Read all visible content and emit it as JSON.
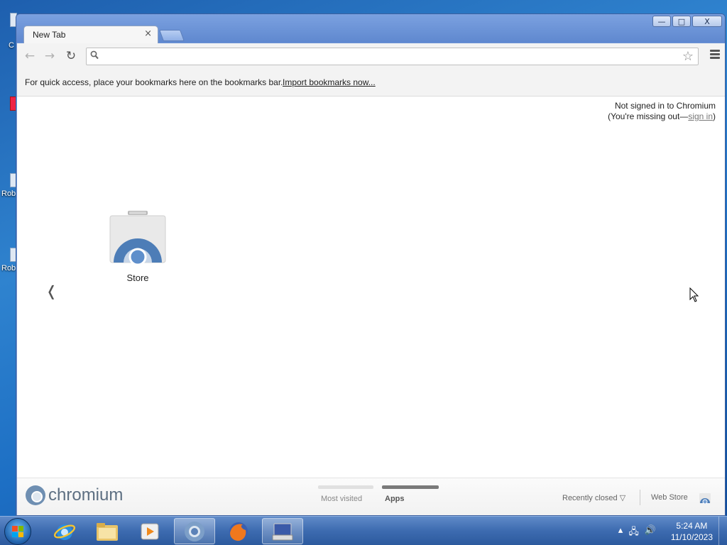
{
  "desktop": {
    "icon_labels": [
      "C",
      "Rob",
      "Rob"
    ]
  },
  "window": {
    "controls": {
      "minimize": "—",
      "maximize": "□",
      "close": "X"
    }
  },
  "tab": {
    "title": "New Tab",
    "close": "×"
  },
  "toolbar": {
    "back": "←",
    "forward": "→",
    "reload": "↻",
    "omnibox_value": "",
    "omnibox_placeholder": "",
    "search_icon": "magnifier-icon",
    "star": "☆"
  },
  "bookmarks_bar": {
    "message": "For quick access, place your bookmarks here on the bookmarks bar.",
    "import_link": "Import bookmarks now..."
  },
  "signin": {
    "line1": "Not signed in to Chromium",
    "line2_prefix": "(You're missing out—",
    "link": "sign in",
    "line2_suffix": ")"
  },
  "apps": [
    {
      "label": "Store",
      "icon": "web-store-icon"
    }
  ],
  "pager": {
    "prev": "❬"
  },
  "footer": {
    "brand": "chromium",
    "sections": [
      {
        "label": "Most visited",
        "active": false
      },
      {
        "label": "Apps",
        "active": true
      }
    ],
    "recently_closed": "Recently closed ▽",
    "web_store": "Web Store"
  },
  "taskbar": {
    "items": [
      "start-button",
      "internet-explorer-icon",
      "file-explorer-icon",
      "media-player-icon",
      "chromium-icon",
      "firefox-icon",
      "keyboard-app-icon"
    ],
    "active_item": "chromium-icon"
  },
  "clock": {
    "time": "5:24 AM",
    "date": "11/10/2023"
  },
  "colors": {
    "titlebar": "#6e95d6",
    "desktop": "#1e5fae",
    "taskbar": "#3d6bb0",
    "content_bg": "#ffffff"
  }
}
